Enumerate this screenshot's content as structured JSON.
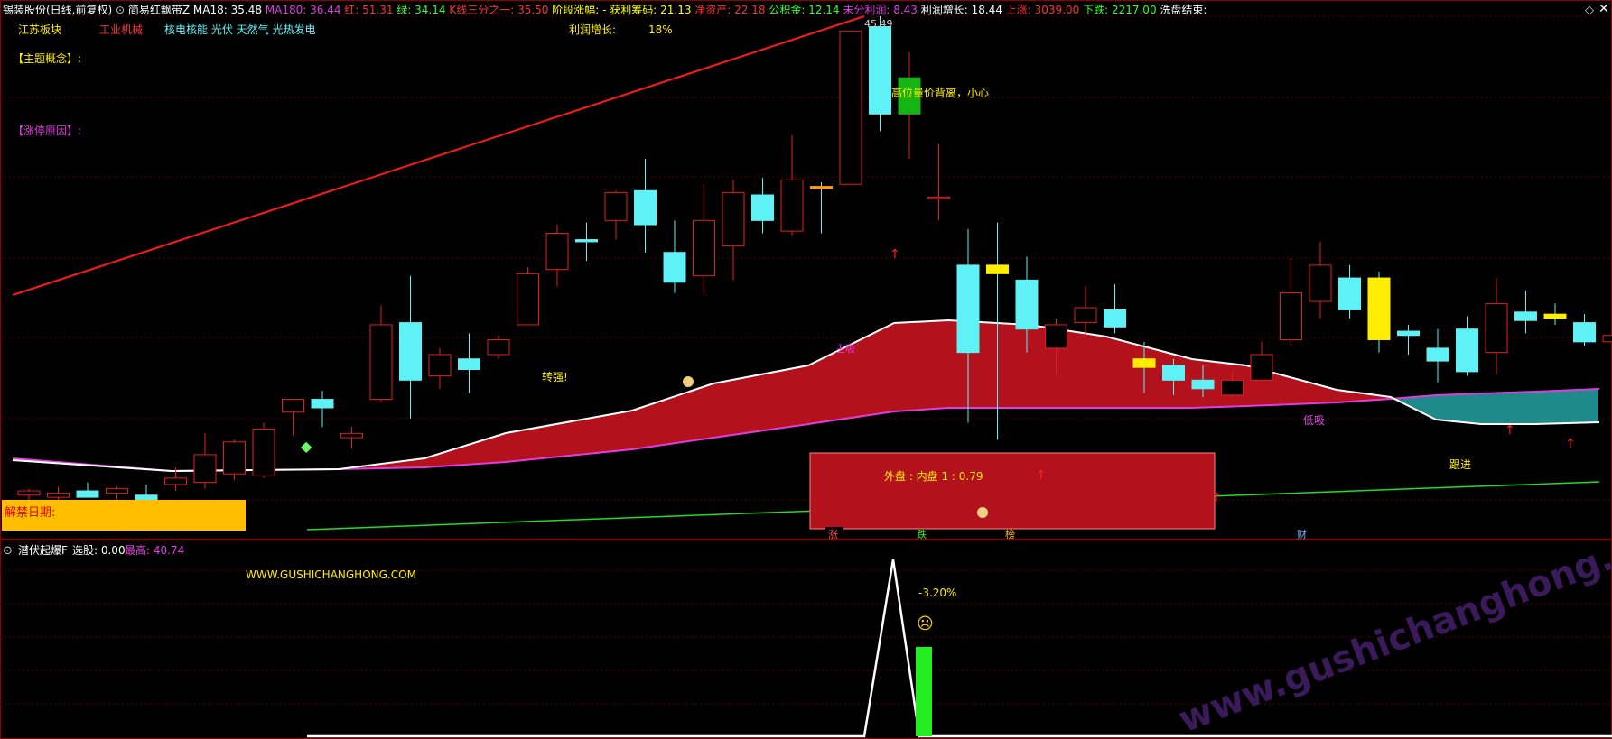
{
  "colors": {
    "bg": "#000000",
    "grid": "#5a0000",
    "border": "#8b0000",
    "up_candle": "#e02020",
    "down_candle": "#5ef2f6",
    "ma_line": "#ffffff",
    "ma180_line": "#e03ce0",
    "trend_red": "#ff1a1a",
    "trend_green": "#22dd22",
    "band_red": "#b3121d",
    "band_teal": "#1f8a8a",
    "yellow": "#ffee00",
    "gold_bar": "#ffbf00"
  },
  "main_header": {
    "stock": "锡装股份(日线,前复权)",
    "indicator": "简易红飘带Z",
    "items": [
      {
        "label": "MA18: 35.48",
        "color": "#ffffff"
      },
      {
        "label": "MA180: 36.44",
        "color": "#e03ce0"
      },
      {
        "label": "红: 51.31",
        "color": "#ff3030"
      },
      {
        "label": "绿: 34.14",
        "color": "#33ff33"
      },
      {
        "label": "K线三分之一: 35.50",
        "color": "#ff3030"
      },
      {
        "label": "阶段涨幅: -",
        "color": "#ffff00"
      },
      {
        "label": "获利筹码: 21.13",
        "color": "#ffff00"
      },
      {
        "label": "净资产: 22.18",
        "color": "#ff3030"
      },
      {
        "label": "公积金: 12.14",
        "color": "#33ff33"
      },
      {
        "label": "未分利润: 8.43",
        "color": "#e03ce0"
      },
      {
        "label": "利润增长: 18.44",
        "color": "#ffffff"
      },
      {
        "label": "上涨: 3039.00",
        "color": "#ff3030"
      },
      {
        "label": "下跌: 2217.00",
        "color": "#33ff33"
      },
      {
        "label": "洗盘结束:",
        "color": "#ffffff"
      }
    ],
    "diamond": "◇"
  },
  "board": {
    "sector": "江苏板块",
    "industry": "工业机械",
    "concepts": "核电核能 光伏 天然气 光热发电",
    "profit_growth_label": "利润增长:",
    "profit_growth_value": "18%",
    "theme_label": "【主题概念】:",
    "limitup_label": "【涨停原因】:"
  },
  "annotations": {
    "high_price": "45.49",
    "warning": "高位量价背离，小心",
    "turn_strong": "转强!",
    "low_buy": "低吸",
    "follow": "跟进",
    "unlock_date": "解禁日期:",
    "outer_inner": "外盘 : 内盘   1 : 0.79",
    "label_zhang": "涨",
    "label_die": "跌",
    "label_bang": "榜",
    "label_cai": "财",
    "band_label": "主吸"
  },
  "sub_header": {
    "indicator": "潜伏起爆F",
    "select_label": "选股: 0.00",
    "max_label": "最高: 40.74"
  },
  "sub_annotations": {
    "website": "WWW.GUSHICHANGHONG.COM",
    "pct": "-3.20%",
    "face": "☹",
    "watermark": "www.gushichanghong.com"
  },
  "chart_data": {
    "type": "candlestick",
    "price_high": 45.49,
    "candles": [
      {
        "o": 23.0,
        "h": 23.3,
        "l": 22.7,
        "c": 23.2
      },
      {
        "o": 22.9,
        "h": 23.4,
        "l": 22.6,
        "c": 23.1
      },
      {
        "o": 23.2,
        "h": 23.6,
        "l": 22.9,
        "c": 22.9
      },
      {
        "o": 23.1,
        "h": 23.4,
        "l": 22.8,
        "c": 23.3
      },
      {
        "o": 23.0,
        "h": 23.5,
        "l": 22.7,
        "c": 22.8
      },
      {
        "o": 23.5,
        "h": 24.3,
        "l": 23.2,
        "c": 23.8
      },
      {
        "o": 23.6,
        "h": 25.9,
        "l": 23.3,
        "c": 24.9
      },
      {
        "o": 24.0,
        "h": 25.6,
        "l": 23.7,
        "c": 25.5
      },
      {
        "o": 23.9,
        "h": 26.4,
        "l": 23.8,
        "c": 26.1
      },
      {
        "o": 26.9,
        "h": 27.4,
        "l": 25.8,
        "c": 27.5
      },
      {
        "o": 27.5,
        "h": 27.9,
        "l": 26.2,
        "c": 27.1
      },
      {
        "o": 25.7,
        "h": 26.2,
        "l": 25.2,
        "c": 25.9
      },
      {
        "o": 27.5,
        "h": 31.9,
        "l": 27.4,
        "c": 31.0
      },
      {
        "o": 31.1,
        "h": 33.3,
        "l": 26.6,
        "c": 28.4
      },
      {
        "o": 28.6,
        "h": 29.9,
        "l": 28.0,
        "c": 29.6
      },
      {
        "o": 29.4,
        "h": 30.6,
        "l": 27.8,
        "c": 28.9
      },
      {
        "o": 29.6,
        "h": 30.5,
        "l": 29.4,
        "c": 30.3
      },
      {
        "o": 31.0,
        "h": 33.7,
        "l": 31.0,
        "c": 33.4
      },
      {
        "o": 33.6,
        "h": 35.7,
        "l": 32.8,
        "c": 35.3
      },
      {
        "o": 35.0,
        "h": 35.8,
        "l": 34.0,
        "c": 34.9
      },
      {
        "o": 35.9,
        "h": 37.3,
        "l": 35.0,
        "c": 37.2
      },
      {
        "o": 37.3,
        "h": 38.8,
        "l": 34.4,
        "c": 35.7
      },
      {
        "o": 34.4,
        "h": 35.9,
        "l": 32.5,
        "c": 33.0
      },
      {
        "o": 33.3,
        "h": 37.6,
        "l": 32.4,
        "c": 35.9
      },
      {
        "o": 34.7,
        "h": 37.8,
        "l": 33.1,
        "c": 37.2
      },
      {
        "o": 37.1,
        "h": 37.9,
        "l": 35.3,
        "c": 35.9
      },
      {
        "o": 35.4,
        "h": 39.9,
        "l": 35.2,
        "c": 37.8
      },
      {
        "o": 37.5,
        "h": 37.7,
        "l": 35.3,
        "c": 37.4
      },
      {
        "o": 37.6,
        "h": 44.8,
        "l": 37.6,
        "c": 44.8
      },
      {
        "o": 45.0,
        "h": 45.49,
        "l": 40.1,
        "c": 40.9
      },
      {
        "o": 40.9,
        "h": 43.8,
        "l": 38.8,
        "c": 42.6
      },
      {
        "o": 37.0,
        "h": 39.5,
        "l": 35.9,
        "c": 37.0
      },
      {
        "o": 33.8,
        "h": 35.5,
        "l": 26.4,
        "c": 29.7
      },
      {
        "o": 33.8,
        "h": 35.8,
        "l": 25.6,
        "c": 33.4
      },
      {
        "o": 33.1,
        "h": 34.2,
        "l": 29.7,
        "c": 30.8
      },
      {
        "o": 29.9,
        "h": 31.3,
        "l": 28.6,
        "c": 31.0
      },
      {
        "o": 31.1,
        "h": 32.8,
        "l": 30.5,
        "c": 31.8
      },
      {
        "o": 31.7,
        "h": 32.9,
        "l": 30.6,
        "c": 30.9
      },
      {
        "o": 29.4,
        "h": 30.2,
        "l": 27.8,
        "c": 29.0
      },
      {
        "o": 29.1,
        "h": 29.4,
        "l": 27.7,
        "c": 28.4
      },
      {
        "o": 28.4,
        "h": 29.1,
        "l": 27.6,
        "c": 28.0
      },
      {
        "o": 27.7,
        "h": 28.8,
        "l": 27.6,
        "c": 28.4
      },
      {
        "o": 28.4,
        "h": 30.2,
        "l": 28.4,
        "c": 29.6
      },
      {
        "o": 30.3,
        "h": 34.1,
        "l": 30.0,
        "c": 32.5
      },
      {
        "o": 32.1,
        "h": 34.9,
        "l": 31.3,
        "c": 33.8
      },
      {
        "o": 33.2,
        "h": 33.8,
        "l": 31.3,
        "c": 31.7
      },
      {
        "o": 33.2,
        "h": 33.5,
        "l": 29.7,
        "c": 30.3
      },
      {
        "o": 30.7,
        "h": 31.0,
        "l": 29.6,
        "c": 30.5
      },
      {
        "o": 29.9,
        "h": 30.8,
        "l": 28.3,
        "c": 29.3
      },
      {
        "o": 30.8,
        "h": 31.4,
        "l": 28.6,
        "c": 28.8
      },
      {
        "o": 29.7,
        "h": 33.2,
        "l": 28.7,
        "c": 32.0
      },
      {
        "o": 31.6,
        "h": 32.6,
        "l": 30.6,
        "c": 31.2
      },
      {
        "o": 31.5,
        "h": 32.0,
        "l": 31.0,
        "c": 31.3
      },
      {
        "o": 31.1,
        "h": 31.5,
        "l": 30.0,
        "c": 30.2
      },
      {
        "o": 30.2,
        "h": 31.0,
        "l": 29.7,
        "c": 30.5
      },
      {
        "o": 31.1,
        "h": 31.5,
        "l": 29.8,
        "c": 30.1
      }
    ]
  }
}
